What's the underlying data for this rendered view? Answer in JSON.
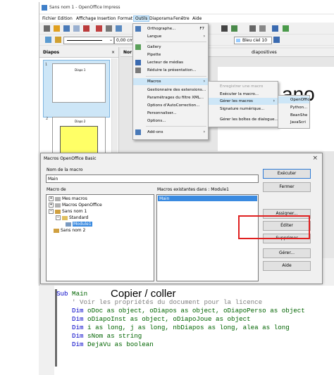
{
  "window": {
    "title": "Sans nom 1 - OpenOffice Impress"
  },
  "menubar": [
    "Fichier",
    "Edition",
    "Affichage",
    "Insertion",
    "Format",
    "Outils",
    "Diaporama",
    "Fenêtre",
    "Aide"
  ],
  "toolbar2": {
    "size_value": "0,00 cm",
    "color_value": "Bleu ciel 10"
  },
  "panel": {
    "title": "Diapos",
    "slide1_label": "Diapo 1",
    "slide2_label": "Diapo 2",
    "slide1_num": "1",
    "slide2_num": "2"
  },
  "editor": {
    "tab_normal": "Nor",
    "tab_header": "diapositives",
    "big_text_fragment": "ano"
  },
  "outils_menu": {
    "items": [
      {
        "label": "Orthographe...",
        "shortcut": "F7"
      },
      {
        "label": "Langue",
        "submenu": true
      },
      {
        "label": "Gallery"
      },
      {
        "label": "Pipette"
      },
      {
        "label": "Lecteur de médias"
      },
      {
        "label": "Réduire la présentation..."
      },
      {
        "label": "Macros",
        "submenu": true
      },
      {
        "label": "Gestionnaire des extensions..."
      },
      {
        "label": "Paramétrages du filtre XML..."
      },
      {
        "label": "Options d'AutoCorrection..."
      },
      {
        "label": "Personnaliser..."
      },
      {
        "label": "Options..."
      },
      {
        "label": "Add-ons",
        "submenu": true
      }
    ]
  },
  "macros_submenu": [
    "Enregistrer une macro",
    "Exécuter la macro...",
    "Gérer les macros",
    "Signature numérique...",
    "Gérer les boîtes de dialogue..."
  ],
  "gerer_submenu": [
    "OpenOffice",
    "Python...",
    "BeanShe",
    "JavaScri"
  ],
  "dialog": {
    "title": "Macros OpenOffice Basic",
    "name_label": "Nom de la macro",
    "name_value": "Main",
    "from_label": "Macro de",
    "existing_label": "Macros existantes dans : Module1",
    "existing_items": [
      "Main"
    ],
    "tree": [
      "Mes macros",
      "Macros OpenOffice",
      "Sans nom 1",
      "Standard",
      "Module1",
      "Sans nom 2"
    ],
    "buttons": {
      "run": "Exécuter",
      "close": "Fermer",
      "assign": "Assigner...",
      "edit": "Éditer",
      "delete": "Supprimer",
      "manage": "Gérer...",
      "help": "Aide"
    }
  },
  "code": {
    "overlay_label": "Copier / coller",
    "lines": [
      [
        "Sub",
        " Main"
      ],
      [
        "' Voir les propriétés du document pour la licence"
      ],
      [
        "Dim",
        " oDoc as object, oDiapos as object, oDiapoPerso as object"
      ],
      [
        "Dim",
        " oDiapoInst as object, oDiapoJoue as object"
      ],
      [
        "Dim",
        " i as long, j as long, nbDiapos as long, alea as long"
      ],
      [
        "Dim",
        " sNom as string"
      ],
      [
        "Dim",
        " DejaVu as boolean"
      ]
    ]
  },
  "colors": {
    "highlight": "#cde6f7",
    "annotation_box": "#e02020",
    "slide_fill": "#ffff66",
    "keyword": "#0000c8"
  }
}
